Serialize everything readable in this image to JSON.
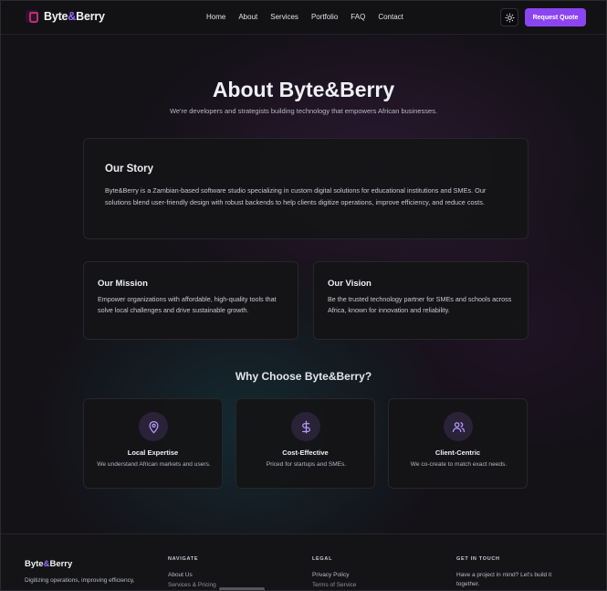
{
  "nav": {
    "brand_prefix": "Byte",
    "brand_amp": "&",
    "brand_suffix": "Berry",
    "links": [
      "Home",
      "About",
      "Services",
      "Portfolio",
      "FAQ",
      "Contact"
    ],
    "theme_icon": "sun-icon",
    "cta": "Request Quote"
  },
  "hero": {
    "title": "About Byte&Berry",
    "subtitle": "We're developers and strategists building technology that empowers African businesses."
  },
  "story": {
    "title": "Our Story",
    "body": "Byte&Berry is a Zambian-based software studio specializing in custom digital solutions for educational institutions and SMEs. Our solutions blend user-friendly design with robust backends to help clients digitize operations, improve efficiency, and reduce costs."
  },
  "mission": {
    "title": "Our Mission",
    "body": "Empower organizations with affordable, high-quality tools that solve local challenges and drive sustainable growth."
  },
  "vision": {
    "title": "Our Vision",
    "body": "Be the trusted technology partner for SMEs and schools across Africa, known for innovation and reliability."
  },
  "why": {
    "title": "Why Choose Byte&Berry?",
    "features": [
      {
        "icon": "map-pin-icon",
        "title": "Local Expertise",
        "body": "We understand African markets and users."
      },
      {
        "icon": "dollar-icon",
        "title": "Cost-Effective",
        "body": "Priced for startups and SMEs."
      },
      {
        "icon": "users-icon",
        "title": "Client-Centric",
        "body": "We co-create to match exact needs."
      }
    ]
  },
  "footer": {
    "brand_prefix": "Byte",
    "brand_amp": "&",
    "brand_suffix": "Berry",
    "description": "Digitizing operations, improving efficiency,",
    "navigate": {
      "heading": "NAVIGATE",
      "links": [
        "About Us",
        "Services & Pricing"
      ]
    },
    "legal": {
      "heading": "LEGAL",
      "links": [
        "Privacy Policy",
        "Terms of Service"
      ]
    },
    "contact": {
      "heading": "GET IN TOUCH",
      "text": "Have a project in mind? Let's build it together."
    }
  },
  "colors": {
    "accent": "#8b45f0",
    "brand_amp": "#9b6cff",
    "icon": "#b79cff"
  }
}
